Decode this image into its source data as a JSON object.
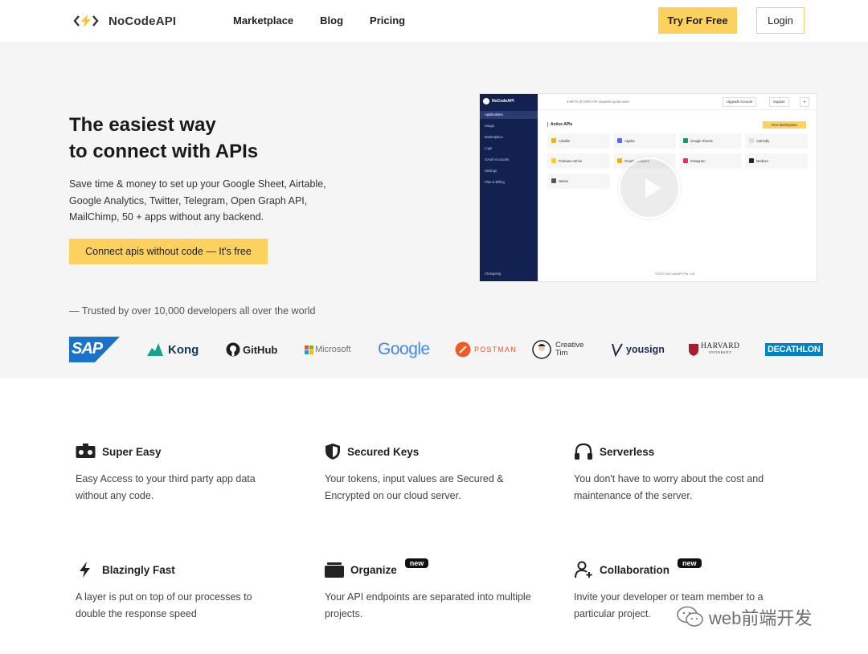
{
  "header": {
    "logo_text": "NoCodeAPI",
    "nav": [
      "Marketplace",
      "Blog",
      "Pricing"
    ],
    "try_label": "Try For Free",
    "login_label": "Login"
  },
  "hero": {
    "title_line1": "The easiest way",
    "title_line2": "to connect with APIs",
    "description": "Save time & money to set up your Google Sheet, Airtable, Google Analytics, Twitter, Telegram, Open Graph API, MailChimp, 50 + apps without any backend.",
    "cta_label": "Connect apis without code — It's free",
    "trusted": "— Trusted by over 10,000 developers all over the world"
  },
  "brands": {
    "sap": "SAP",
    "kong": "Kong",
    "github": "GitHub",
    "microsoft": "Microsoft",
    "google": "Google",
    "postman": "POSTMAN",
    "creative_tim_1": "Creative",
    "creative_tim_2": "Tim",
    "yousign": "yousign",
    "harvard": "HARVARD",
    "harvard_sub": "UNIVERSITY",
    "decathlon": "DECATHLON"
  },
  "preview": {
    "brand": "NoCodeAPI",
    "menu": [
      "Applications",
      "Usage",
      "Marketplace",
      "Logs",
      "OAuth Accounts",
      "Settings",
      "Plan & Billing"
    ],
    "footer": "Changelog",
    "quota": "3.667% (9,700/0 API requests quota used",
    "upgrade": "Upgrade Account",
    "support": "Support",
    "heading": "Active APIs",
    "marketplace_btn": "View Marketplace",
    "apps": [
      "Airtable",
      "Algolia",
      "Google Sheets",
      "Calendly",
      "Firebase Admin",
      "Google analytics",
      "Instagram",
      "Medium",
      "Notion"
    ],
    "copyright": "©2022 NoCodeAPI Pte. Ltd."
  },
  "features": [
    {
      "title": "Super Easy",
      "desc": "Easy Access to your third party app data without any code.",
      "icon": "vr-headset-icon"
    },
    {
      "title": "Secured Keys",
      "desc": "Your tokens, input values are Secured & Encrypted on our cloud server.",
      "icon": "shield-icon"
    },
    {
      "title": "Serverless",
      "desc": "You don't have to worry about the cost and maintenance of the server.",
      "icon": "headphones-icon"
    },
    {
      "title": "Blazingly Fast",
      "desc": "A layer is put on top of our processes to double the response speed",
      "icon": "lightning-icon"
    },
    {
      "title": "Organize",
      "badge": "new",
      "desc": "Your API endpoints are separated into multiple projects.",
      "icon": "folder-icon"
    },
    {
      "title": "Collaboration",
      "badge": "new",
      "desc": "Invite your developer or team member to a particular project.",
      "icon": "user-add-icon"
    }
  ],
  "watermark": "web前端开发"
}
